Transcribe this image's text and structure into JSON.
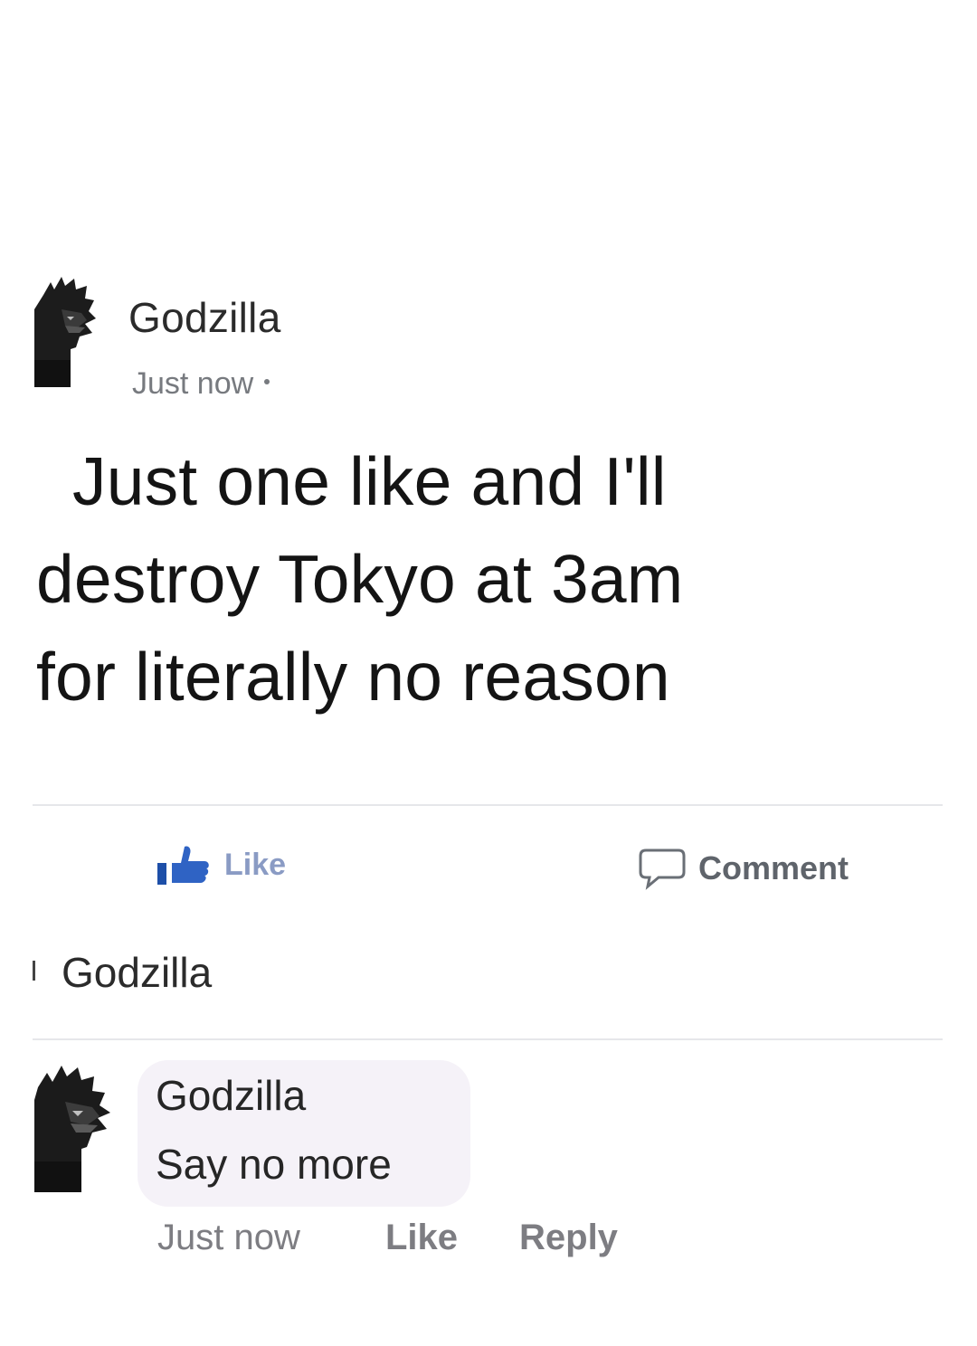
{
  "post": {
    "author": "Godzilla",
    "time": "Just now",
    "body_lines": [
      "Just one like and I'll",
      "destroy Tokyo at 3am",
      "for literally no reason"
    ],
    "avatar_icon": "godzilla-avatar"
  },
  "actions": {
    "like_label": "Like",
    "like_icon": "thumbs-up-icon",
    "comment_label": "Comment",
    "comment_icon": "speech-bubble-icon",
    "like_color": "#4267b2"
  },
  "reactions": {
    "liked_by": "Godzilla"
  },
  "comment": {
    "author": "Godzilla",
    "text": "Say no more",
    "time": "Just now",
    "like_label": "Like",
    "reply_label": "Reply",
    "bubble_color": "#f5f2f8"
  }
}
